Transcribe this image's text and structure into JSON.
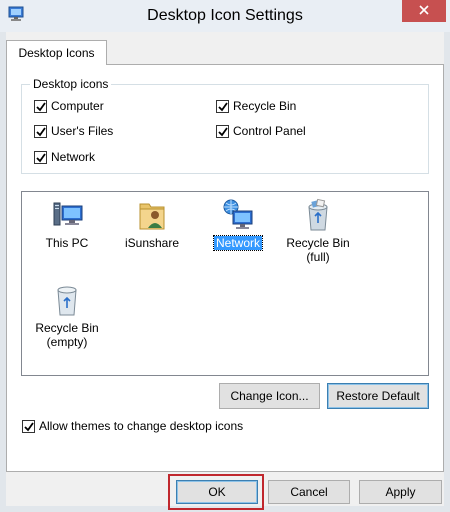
{
  "window": {
    "title": "Desktop Icon Settings"
  },
  "tabs": [
    {
      "label": "Desktop Icons"
    }
  ],
  "desktop_icons_group": {
    "legend": "Desktop icons",
    "checkboxes": [
      {
        "label": "Computer",
        "checked": true
      },
      {
        "label": "User's Files",
        "checked": true
      },
      {
        "label": "Network",
        "checked": true
      },
      {
        "label": "Recycle Bin",
        "checked": true
      },
      {
        "label": "Control Panel",
        "checked": true
      }
    ]
  },
  "icon_list": {
    "items": [
      {
        "label": "This PC",
        "icon": "this-pc-icon"
      },
      {
        "label": "iSunshare",
        "icon": "user-folder-icon"
      },
      {
        "label": "Network",
        "icon": "network-icon",
        "selected": true
      },
      {
        "label": "Recycle Bin\n(full)",
        "line1": "Recycle Bin",
        "line2": "(full)",
        "icon": "recycle-bin-full-icon"
      },
      {
        "label": "Recycle Bin\n(empty)",
        "line1": "Recycle Bin",
        "line2": "(empty)",
        "icon": "recycle-bin-empty-icon"
      }
    ]
  },
  "icon_buttons": {
    "change_icon": "Change Icon...",
    "restore_default": "Restore Default"
  },
  "allow_themes": {
    "label": "Allow themes to change desktop icons",
    "checked": true
  },
  "footer": {
    "ok": "OK",
    "cancel": "Cancel",
    "apply": "Apply"
  },
  "colors": {
    "selection": "#3399ff",
    "close_button": "#c75050",
    "highlight_box": "#c0272d"
  }
}
